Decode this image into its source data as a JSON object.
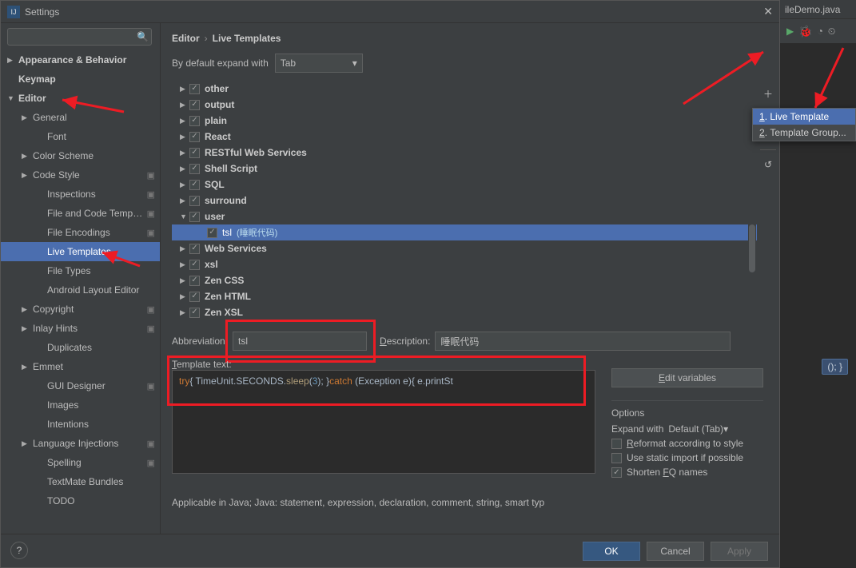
{
  "window": {
    "title": "Settings"
  },
  "search": {
    "placeholder": ""
  },
  "nav": {
    "appearance": "Appearance & Behavior",
    "keymap": "Keymap",
    "editor": "Editor",
    "general": "General",
    "font": "Font",
    "colorScheme": "Color Scheme",
    "codeStyle": "Code Style",
    "inspections": "Inspections",
    "fileCodeTemplates": "File and Code Templates",
    "fileEncodings": "File Encodings",
    "liveTemplates": "Live Templates",
    "fileTypes": "File Types",
    "androidLayoutEditor": "Android Layout Editor",
    "copyright": "Copyright",
    "inlayHints": "Inlay Hints",
    "duplicates": "Duplicates",
    "emmet": "Emmet",
    "guiDesigner": "GUI Designer",
    "images": "Images",
    "intentions": "Intentions",
    "languageInjections": "Language Injections",
    "spelling": "Spelling",
    "textmateBundles": "TextMate Bundles",
    "todo": "TODO"
  },
  "breadcrumb": {
    "root": "Editor",
    "leaf": "Live Templates"
  },
  "expand": {
    "label": "By default expand with",
    "value": "Tab"
  },
  "templates": [
    {
      "name": "other",
      "expanded": false,
      "checked": true
    },
    {
      "name": "output",
      "expanded": false,
      "checked": true
    },
    {
      "name": "plain",
      "expanded": false,
      "checked": true
    },
    {
      "name": "React",
      "expanded": false,
      "checked": true
    },
    {
      "name": "RESTful Web Services",
      "expanded": false,
      "checked": true
    },
    {
      "name": "Shell Script",
      "expanded": false,
      "checked": true
    },
    {
      "name": "SQL",
      "expanded": false,
      "checked": true
    },
    {
      "name": "surround",
      "expanded": false,
      "checked": true
    },
    {
      "name": "user",
      "expanded": true,
      "checked": true,
      "children": [
        {
          "name": "tsl",
          "desc": "(睡眠代码)",
          "checked": true,
          "selected": true
        }
      ]
    },
    {
      "name": "Web Services",
      "expanded": false,
      "checked": true
    },
    {
      "name": "xsl",
      "expanded": false,
      "checked": true
    },
    {
      "name": "Zen CSS",
      "expanded": false,
      "checked": true
    },
    {
      "name": "Zen HTML",
      "expanded": false,
      "checked": true
    },
    {
      "name": "Zen XSL",
      "expanded": false,
      "checked": true
    }
  ],
  "form": {
    "abbrevLabel": "Abbreviation:",
    "abbrevValue": "tsl",
    "descLabel": "Description:",
    "descValue": "睡眠代码",
    "templateTextLabel": "Template text:",
    "editVars": "Edit variables",
    "code": {
      "pre": "try",
      "seg1": "{ TimeUnit.SECONDS.",
      "sleep": "sleep",
      "paren": "(",
      "num": "3",
      "seg2": "); }",
      "catch": "catch",
      "seg3": " (Exception e){ e.printSt"
    }
  },
  "options": {
    "title": "Options",
    "expandWithLabel": "Expand with",
    "expandWithValue": "Default (Tab)",
    "reformat": "Reformat according to style",
    "staticImport": "Use static import if possible",
    "shorten": "Shorten FQ names"
  },
  "applicable": "Applicable in Java; Java: statement, expression, declaration, comment, string, smart typ",
  "buttons": {
    "ok": "OK",
    "cancel": "Cancel",
    "apply": "Apply"
  },
  "popup": {
    "item1": "Live Template",
    "item2": "Template Group..."
  },
  "behind": {
    "tab": "ileDemo.java",
    "hint": "(); }"
  }
}
